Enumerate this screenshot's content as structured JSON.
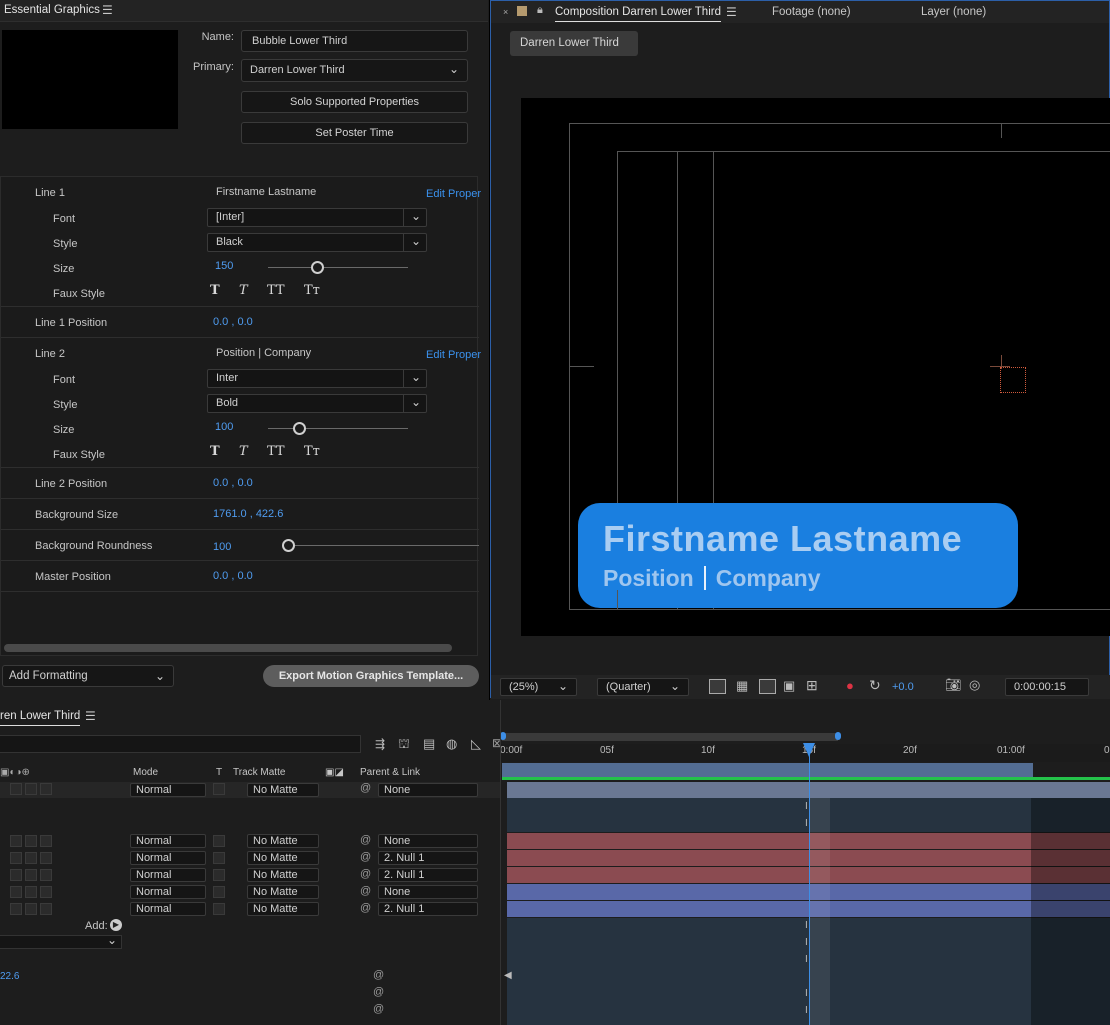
{
  "essential_graphics": {
    "title": "Essential Graphics",
    "name_label": "Name:",
    "name_value": "Bubble Lower Third",
    "primary_label": "Primary:",
    "primary_value": "Darren Lower Third",
    "solo_button": "Solo Supported Properties",
    "poster_button": "Set Poster Time"
  },
  "props": {
    "line1": {
      "label": "Line 1",
      "value": "Firstname Lastname",
      "edit": "Edit Proper",
      "font_label": "Font",
      "font": "[Inter]",
      "style_label": "Style",
      "style": "Black",
      "size_label": "Size",
      "size": "150",
      "size_fraction": 0.35,
      "faux_label": "Faux Style"
    },
    "line1pos": {
      "label": "Line 1 Position",
      "value": "0.0 , 0.0"
    },
    "line2": {
      "label": "Line 2",
      "value": "Position | Company",
      "edit": "Edit Proper",
      "font_label": "Font",
      "font": "Inter",
      "style_label": "Style",
      "style": "Bold",
      "size_label": "Size",
      "size": "100",
      "size_fraction": 0.22,
      "faux_label": "Faux Style"
    },
    "line2pos": {
      "label": "Line 2 Position",
      "value": "0.0 , 0.0"
    },
    "bgsize": {
      "label": "Background Size",
      "value": "1761.0 , 422.6"
    },
    "bground": {
      "label": "Background Roundness",
      "value": "100",
      "fraction": 0.0
    },
    "masterpos": {
      "label": "Master Position",
      "value": "0.0 , 0.0"
    },
    "faux_glyphs": [
      "T",
      "T",
      "TT",
      "Tт"
    ]
  },
  "add_formatting": "Add Formatting",
  "export_button": "Export Motion Graphics Template...",
  "comp": {
    "tab": "Composition Darren Lower Third",
    "footage": "Footage (none)",
    "layer": "Layer (none)",
    "subtab": "Darren Lower Third",
    "line1": "Firstname Lastname",
    "line2a": "Position",
    "line2b": "Company",
    "zoom": "(25%)",
    "quality": "(Quarter)",
    "exposure": "+0.0",
    "timecode": "0:00:00:15"
  },
  "timeline": {
    "tab": "ren Lower Third",
    "ruler": [
      "0:00f",
      "05f",
      "10f",
      "15f",
      "20f",
      "01:00f",
      "0"
    ],
    "headers": {
      "mode": "Mode",
      "t": "T",
      "track_matte": "Track Matte",
      "parent": "Parent & Link"
    },
    "rows": [
      {
        "mode": "Normal",
        "matte": "No Matte",
        "parent": "None"
      },
      {
        "mode": "Normal",
        "matte": "No Matte",
        "parent": "None"
      },
      {
        "mode": "Normal",
        "matte": "No Matte",
        "parent": "2. Null 1"
      },
      {
        "mode": "Normal",
        "matte": "No Matte",
        "parent": "2. Null 1"
      },
      {
        "mode": "Normal",
        "matte": "No Matte",
        "parent": "None"
      },
      {
        "mode": "Normal",
        "matte": "No Matte",
        "parent": "2. Null 1"
      }
    ],
    "add": "Add:",
    "value_fragment": "22.6"
  }
}
